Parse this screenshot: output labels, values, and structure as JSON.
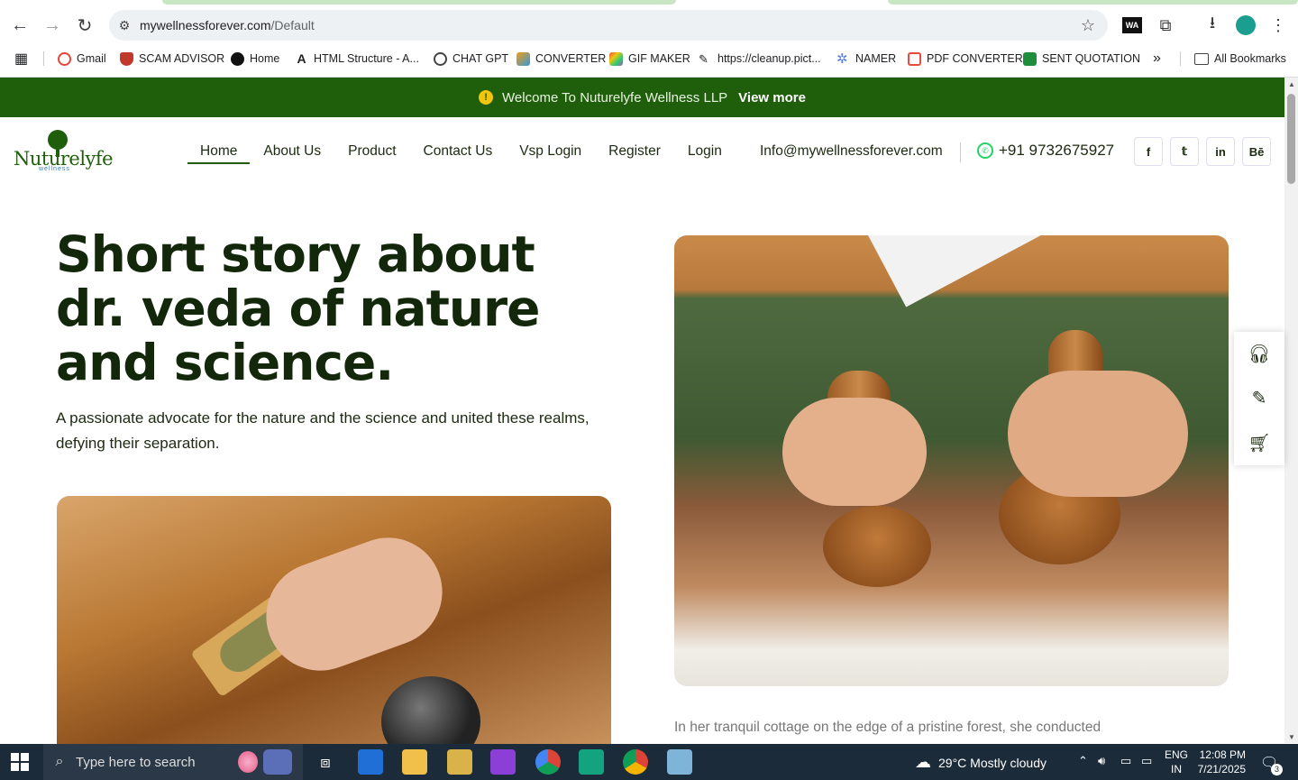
{
  "browser": {
    "url_main": "mywellnessforever.com",
    "url_path": "/Default",
    "bookmarks": [
      {
        "label": "Gmail"
      },
      {
        "label": "SCAM ADVISOR"
      },
      {
        "label": "Home"
      },
      {
        "label": "HTML Structure - A..."
      },
      {
        "label": "CHAT GPT"
      },
      {
        "label": "CONVERTER"
      },
      {
        "label": "GIF MAKER"
      },
      {
        "label": "https://cleanup.pict..."
      },
      {
        "label": "NAMER"
      },
      {
        "label": "PDF CONVERTER"
      },
      {
        "label": "SENT QUOTATION"
      }
    ],
    "more_bookmarks": "»",
    "all_bookmarks": "All Bookmarks",
    "toolbar_badge": "WA"
  },
  "banner": {
    "text": "Welcome To Nuturelyfe Wellness LLP",
    "link": "View more",
    "icon": "!"
  },
  "site": {
    "logo_name": "Nuturelyfe",
    "logo_sub": "wellness",
    "nav": [
      {
        "label": "Home"
      },
      {
        "label": "About Us"
      },
      {
        "label": "Product"
      },
      {
        "label": "Contact Us"
      },
      {
        "label": "Vsp Login"
      },
      {
        "label": "Register"
      },
      {
        "label": "Login"
      }
    ],
    "email": "Info@mywellnessforever.com",
    "phone": "+91 9732675927",
    "social": [
      {
        "label": "f"
      },
      {
        "label": "𝕥"
      },
      {
        "label": "in"
      },
      {
        "label": "Bē"
      }
    ]
  },
  "hero": {
    "title": "Short story about dr. veda of nature and science.",
    "subtitle": "A passionate advocate for the nature and the science and united these realms, defying their separation.",
    "caption": "In her tranquil cottage on the edge of a pristine forest, she conducted"
  },
  "float_panel": {
    "icons": [
      "headset-icon",
      "pencil-icon",
      "cart-icon"
    ]
  },
  "taskbar": {
    "search_placeholder": "Type here to search",
    "weather": "29°C  Mostly cloudy",
    "lang_top": "ENG",
    "lang_bottom": "IN",
    "time": "12:08 PM",
    "date": "7/21/2025",
    "notifications": "3"
  },
  "colors": {
    "brand_green": "#1f5f0b",
    "text_dark": "#13280b",
    "taskbar": "#1c2b3a"
  }
}
